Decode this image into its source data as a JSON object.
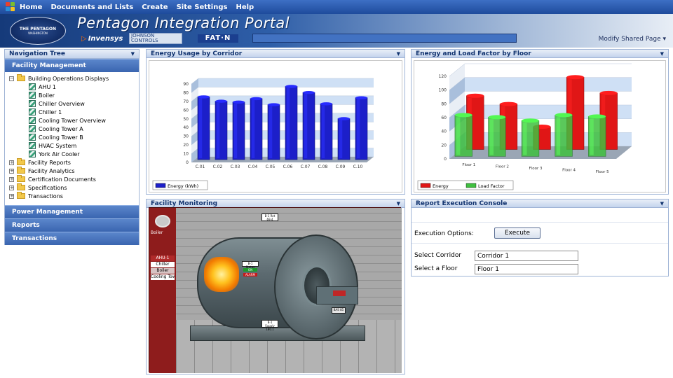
{
  "top_menu": [
    "Home",
    "Documents and Lists",
    "Create",
    "Site Settings",
    "Help"
  ],
  "banner": {
    "seal_title": "THE PENTAGON",
    "seal_subtitle": "WASHINGTON",
    "portal_title": "Pentagon Integration Portal",
    "invensys": "Invensys",
    "jci": "JOHNSON CONTROLS",
    "eaton": "FAT·N",
    "modify": "Modify Shared Page ▾"
  },
  "nav": {
    "title": "Navigation Tree",
    "section_main": "Facility Management",
    "tree": [
      {
        "label": "Building Operations Displays",
        "type": "folder",
        "expander": "−"
      },
      {
        "label": "AHU 1",
        "type": "doc"
      },
      {
        "label": "Boiler",
        "type": "doc"
      },
      {
        "label": "Chiller Overview",
        "type": "doc"
      },
      {
        "label": "Chiller 1",
        "type": "doc"
      },
      {
        "label": "Cooling Tower Overview",
        "type": "doc"
      },
      {
        "label": "Cooling Tower A",
        "type": "doc"
      },
      {
        "label": "Cooling Tower B",
        "type": "doc"
      },
      {
        "label": "HVAC System",
        "type": "doc"
      },
      {
        "label": "York Air Cooler",
        "type": "doc"
      },
      {
        "label": "Facility Reports",
        "type": "folder",
        "expander": "+"
      },
      {
        "label": "Facility Analytics",
        "type": "folder",
        "expander": "+"
      },
      {
        "label": "Certification Documents",
        "type": "folder",
        "expander": "+"
      },
      {
        "label": "Specifications",
        "type": "folder",
        "expander": "+"
      },
      {
        "label": "Transactions",
        "type": "folder",
        "expander": "+"
      }
    ],
    "sections": [
      "Power Management",
      "Reports",
      "Transactions"
    ]
  },
  "panels": {
    "energy_corridor": "Energy Usage by Corridor",
    "energy_floor": "Energy and Load Factor by Floor",
    "monitoring": "Facility Monitoring",
    "console": "Report Execution Console"
  },
  "monitoring": {
    "side_items": [
      "Boiler",
      "AHU-1",
      "Chiller",
      "Boiler",
      "Cooling Towe"
    ],
    "tags": [
      "B-1 Ret\n69.4",
      "B-1 Status\n",
      "B-1 Supply\n180.1",
      "BAS\n85"
    ],
    "state_on": "ON",
    "state_alarm": "ALARM"
  },
  "console": {
    "execution_label": "Execution Options:",
    "execute_button": "Execute",
    "corridor_label": "Select Corridor",
    "corridor_value": "Corridor 1",
    "floor_label": "Select a Floor",
    "floor_value": "Floor 1"
  },
  "colors": {
    "nav_blue": "#3a65b0",
    "energy_blue": "#1c1fc9",
    "energy_red": "#e01616",
    "load_green": "#3fbf3f"
  },
  "chart_data": [
    {
      "type": "bar",
      "title": "Energy Usage by Corridor",
      "categories": [
        "C.01",
        "C.02",
        "C.03",
        "C.04",
        "C.05",
        "C.06",
        "C.07",
        "C.08",
        "C.09",
        "C.10"
      ],
      "series": [
        {
          "name": "Energy (kWh)",
          "values": [
            72,
            67,
            66,
            70,
            63,
            84,
            77,
            64,
            47,
            71
          ]
        }
      ],
      "ylim": [
        0,
        90
      ],
      "yticks": [
        0,
        10,
        20,
        30,
        40,
        50,
        60,
        70,
        80,
        90
      ],
      "grid": true,
      "legend": "bottom-left"
    },
    {
      "type": "bar",
      "title": "Energy and Load Factor by Floor",
      "categories": [
        "Floor 1",
        "Floor 2",
        "Floor 3",
        "Floor 4",
        "Floor 5"
      ],
      "series": [
        {
          "name": "Energy",
          "values": [
            78,
            66,
            33,
            105,
            82
          ]
        },
        {
          "name": "Load Factor",
          "values": [
            60,
            57,
            52,
            60,
            58
          ]
        }
      ],
      "ylim": [
        0,
        120
      ],
      "yticks": [
        0,
        20,
        40,
        60,
        80,
        100,
        120
      ],
      "grid": true,
      "legend": "bottom-left"
    }
  ]
}
